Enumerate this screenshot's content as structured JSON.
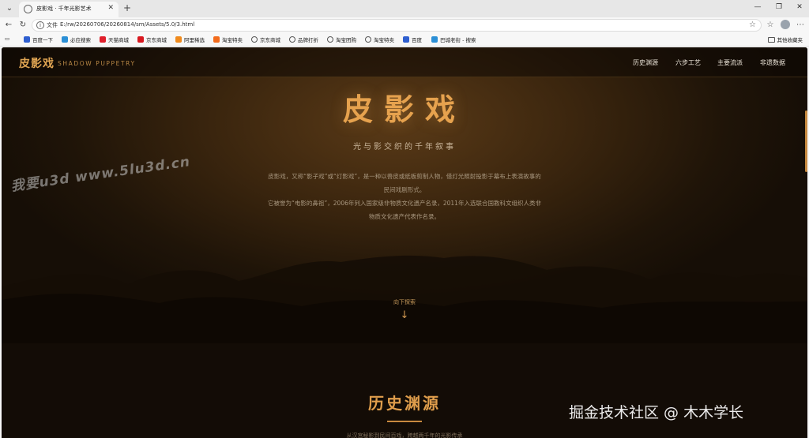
{
  "browser": {
    "tab_title": "皮影戏 · 千年光影艺术",
    "url_scheme": "文件",
    "url": "E:/rw/20260706/20260814/sm/Assets/5.0/3.html",
    "icons": {
      "tab_menu": "chevron-down-icon",
      "close": "close-icon",
      "new_tab": "plus-icon",
      "back": "back-arrow-icon",
      "reload": "reload-icon",
      "favorite": "star-icon",
      "collections": "collections-icon",
      "profile": "profile-avatar-icon",
      "more": "more-icon"
    },
    "bookmarks": [
      "百度一下",
      "必应搜索",
      "天猫商城",
      "京东商城",
      "阿里稀选",
      "淘宝特卖",
      "京东商城",
      "品牌打折",
      "淘宝团购",
      "淘宝特卖",
      "百度",
      "巴城老街 - 搜索"
    ],
    "bookmark_folder": "其他收藏夹"
  },
  "site": {
    "logo_cn": "皮影戏",
    "logo_en": "SHADOW PUPPETRY",
    "nav": [
      "历史渊源",
      "六步工艺",
      "主要流派",
      "非遗数据"
    ],
    "hero_title": "皮影戏",
    "hero_subtitle": "光与影交织的千年叙事",
    "hero_desc_1": "皮影戏，又称“影子戏”或“灯影戏”，是一种以兽皮或纸板剪制人物，借灯光照射投影于幕布上表演故事的民间戏剧形式。",
    "hero_desc_2": "它被誉为“电影的鼻祖”，2006年列入国家级非物质文化遗产名录，2011年入选联合国教科文组织人类非物质文化遗产代表作名录。",
    "explore_label": "向下探索",
    "explore_arrow": "↓",
    "section_title": "历史渊源",
    "section_sub": "从汉宫秘影到民间百戏，跨越两千年的光影传承",
    "colors": {
      "accent": "#e0a553",
      "bg": "#120b05"
    }
  },
  "overlay": {
    "watermark": "我要u3d www.5lu3d.cn",
    "credit": "掘金技术社区 @ 木木学长"
  }
}
